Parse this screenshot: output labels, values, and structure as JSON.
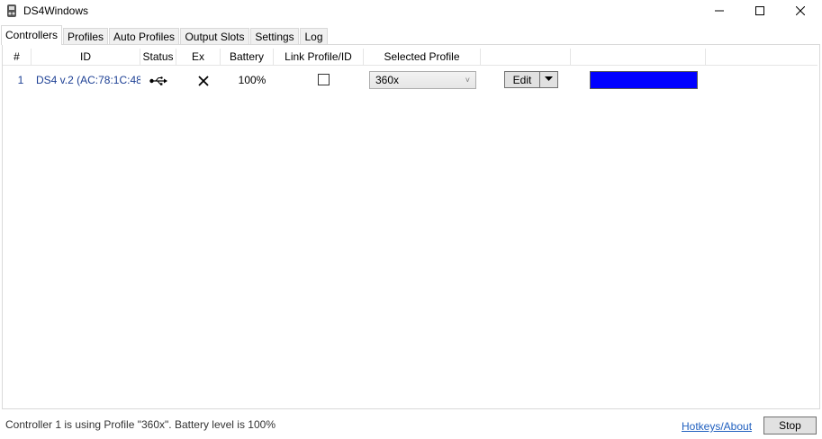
{
  "window": {
    "title": "DS4Windows",
    "minimize_glyph": "—",
    "maximize_glyph": "□",
    "close_glyph": "✕"
  },
  "tabs": [
    {
      "label": "Controllers",
      "active": true
    },
    {
      "label": "Profiles"
    },
    {
      "label": "Auto Profiles"
    },
    {
      "label": "Output Slots"
    },
    {
      "label": "Settings"
    },
    {
      "label": "Log"
    }
  ],
  "grid": {
    "columns": [
      "#",
      "ID",
      "Status",
      "Ex",
      "Battery",
      "Link Profile/ID",
      "Selected Profile"
    ],
    "rows": [
      {
        "index": "1",
        "id": "DS4 v.2 (AC:78:1C:48",
        "status_icon": "usb-icon",
        "ex_icon": "x-icon",
        "battery": "100%",
        "link_checked": false,
        "selected_profile": "360x",
        "edit_label": "Edit",
        "lightbar_color": "#0000ff"
      }
    ]
  },
  "statusbar": {
    "message": "Controller 1 is using Profile \"360x\". Battery level is 100%",
    "hotkeys_label": "Hotkeys/About",
    "stop_label": "Stop"
  }
}
